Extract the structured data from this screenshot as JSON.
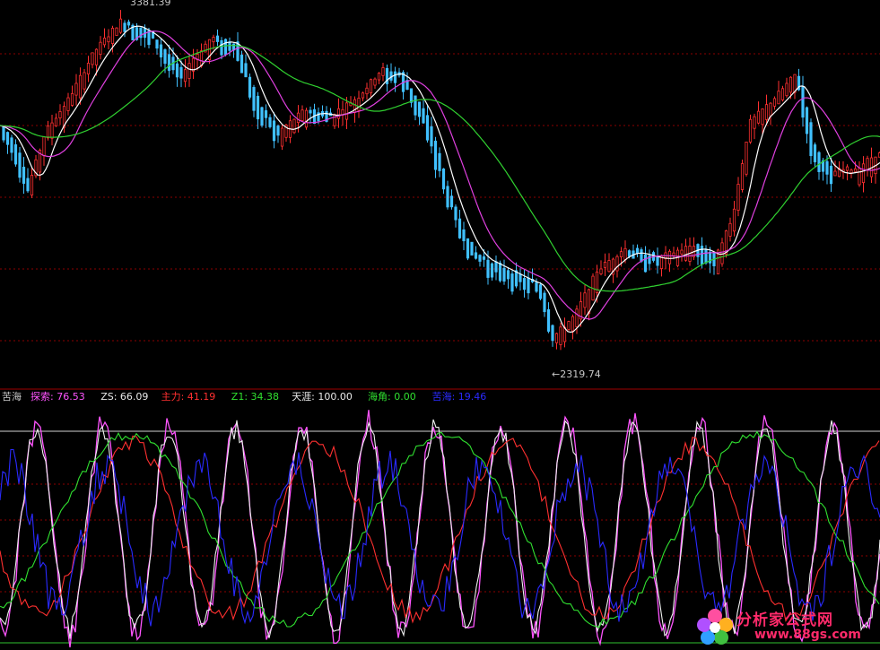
{
  "chart_data": [
    {
      "type": "candlestick",
      "panel": "main",
      "annotations": [
        {
          "label": "3381.39",
          "kind": "high"
        },
        {
          "label": "←2319.74",
          "kind": "low"
        }
      ],
      "series": [
        {
          "color": "#ffffff"
        },
        {
          "color": "#e040e0"
        },
        {
          "color": "#30d030"
        }
      ],
      "grid": "dashed-red-horizontal"
    },
    {
      "type": "line",
      "panel": "indicator",
      "legend": [
        {
          "name": "苦海",
          "value": "",
          "color": "#c8c8c8"
        },
        {
          "name": "探索",
          "value": "76.53",
          "color": "#ff55ff"
        },
        {
          "name": "ZS",
          "value": "66.09",
          "color": "#e8e8e8"
        },
        {
          "name": "主力",
          "value": "41.19",
          "color": "#ff3030"
        },
        {
          "name": "Z1",
          "value": "34.38",
          "color": "#30e030"
        },
        {
          "name": "天涯",
          "value": "100.00",
          "color": "#e8e8e8"
        },
        {
          "name": "海角",
          "value": "0.00",
          "color": "#30e030"
        },
        {
          "name": "苦海",
          "value": "19.46",
          "color": "#2a2aff"
        }
      ]
    }
  ],
  "watermark": {
    "title": "分析家公式网",
    "url": "www.88gs.com"
  },
  "colors": {
    "background": "#000000",
    "grid": "#8b0000",
    "up": "#ff3030",
    "down": "#40c0ff"
  }
}
